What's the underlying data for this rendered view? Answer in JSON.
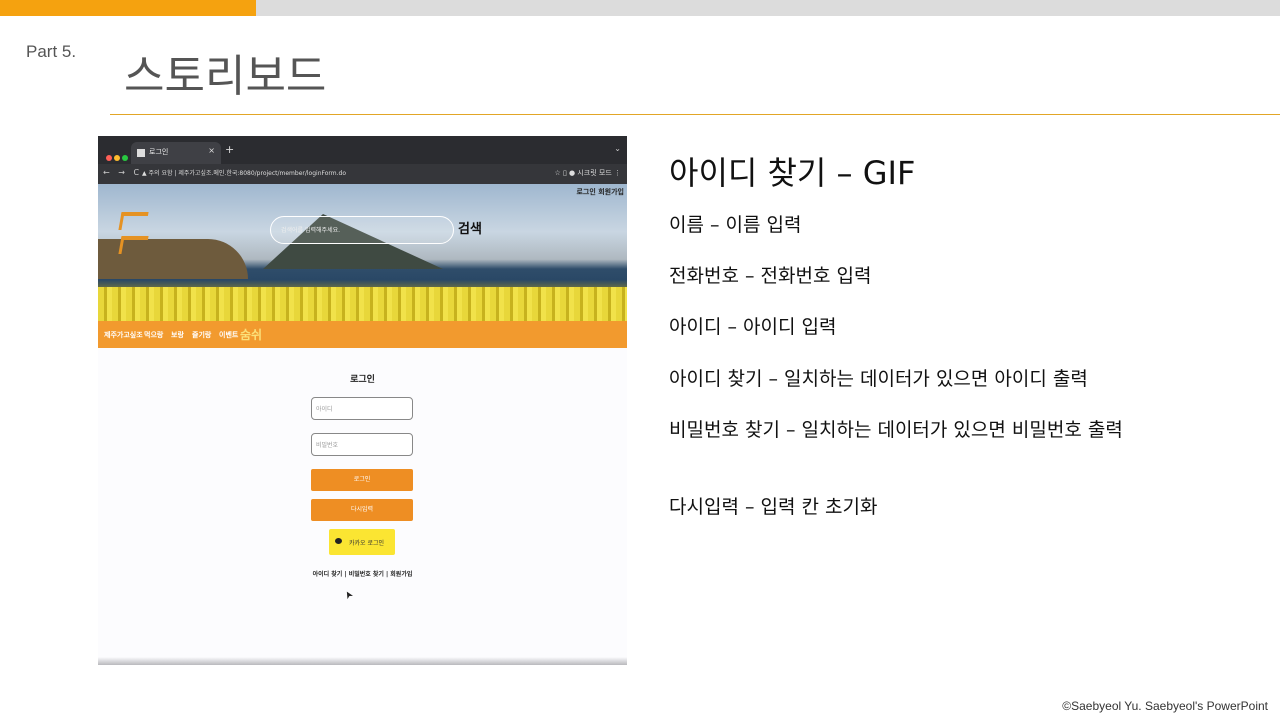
{
  "slide": {
    "part_label": "Part  5.",
    "title": "스토리보드",
    "section_title": "아이디 찾기 – GIF",
    "lines": [
      "이름 – 이름 입력",
      "전화번호 – 전화번호 입력",
      "아이디 – 아이디 입력",
      "아이디 찾기 – 일치하는 데이터가 있으면 아이디 출력",
      "비밀번호 찾기 – 일치하는 데이터가 있으면 비밀번호 출력",
      "다시입력 – 입력 칸 초기화"
    ],
    "footer": "©Saebyeol Yu. Saebyeol's PowerPoint",
    "colors": {
      "accent": "#f5a20f",
      "rule": "#e2a626",
      "topbar": "#dcdcdc"
    }
  },
  "screenshot": {
    "browser": {
      "tab_label": "로그인",
      "tab_close": "×",
      "new_tab": "+",
      "menu": "⌄",
      "nav": "← → C",
      "url": "▲ 주의 요함 | 제주가고싶조.메인.한국:8080/project/member/loginForm.do",
      "right_icons": "☆ ▯ ● 시크릿 모드 ⋮"
    },
    "site": {
      "top_menu": "로그인  회원가입",
      "search_placeholder": "검색어를 입력해주세요.",
      "search_button": "검색",
      "nav_items": [
        "제주가고싶조",
        "먹으랑",
        "보랑",
        "즐기랑",
        "이벤트",
        "숨쉬"
      ],
      "login_title": "로그인",
      "id_placeholder": "아이디",
      "pw_placeholder": "비밀번호",
      "login_button": "로그인",
      "reset_button": "다시입력",
      "kakao_button": "카카오 로그인",
      "links": "아이디 찾기 | 비밀번호 찾기 | 회원가입",
      "cursor": "➤",
      "colors": {
        "nav": "#f29a2e",
        "button": "#ee8e23",
        "kakao": "#fbe532"
      }
    }
  }
}
